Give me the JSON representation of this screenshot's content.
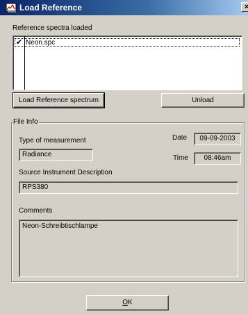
{
  "window": {
    "title": "Load Reference",
    "close_glyph": "×",
    "title_icon": "spectrum-app-icon"
  },
  "reference": {
    "section_label": "Reference spectra loaded",
    "items": [
      {
        "label": "Neon.spc",
        "checked": true
      }
    ],
    "check_glyph": "✔"
  },
  "buttons": {
    "load": "Load Reference spectrum",
    "unload": "Unload",
    "ok_underlined": "O",
    "ok_rest": "K"
  },
  "file_info": {
    "group_label": "File Info",
    "type_label": "Type of measurement",
    "type_value": "Radiance",
    "date_label": "Date",
    "date_value": "09-09-2003",
    "time_label": "Time",
    "time_value": "08:46am",
    "source_label": "Source Instrument Description",
    "source_value": "RPS380",
    "comments_label": "Comments",
    "comments_value": "Neon-Schreibtischlampe"
  }
}
